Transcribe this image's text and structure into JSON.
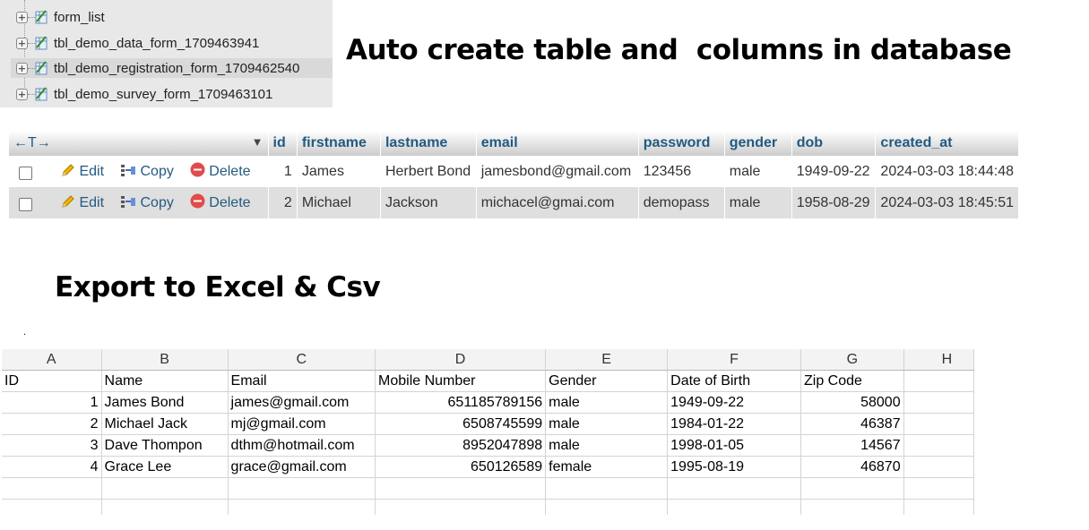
{
  "tree": {
    "items": [
      {
        "label": "form_list"
      },
      {
        "label": "tbl_demo_data_form_1709463941"
      },
      {
        "label": "tbl_demo_registration_form_1709462540"
      },
      {
        "label": "tbl_demo_survey_form_1709463101"
      }
    ]
  },
  "headings": {
    "top": "Auto create table and  columns in database",
    "export": "Export to Excel & Csv",
    "dot": "."
  },
  "dbtable": {
    "columns": [
      "id",
      "firstname",
      "lastname",
      "email",
      "password",
      "gender",
      "dob",
      "created_at"
    ],
    "actions": {
      "edit": "Edit",
      "copy": "Copy",
      "delete": "Delete"
    },
    "rows": [
      [
        "1",
        "James",
        "Herbert Bond",
        "jamesbond@gmail.com",
        "123456",
        "male",
        "1949-09-22",
        "2024-03-03 18:44:48"
      ],
      [
        "2",
        "Michael",
        "Jackson",
        "michacel@gmai.com",
        "demopass",
        "male",
        "1958-08-29",
        "2024-03-03 18:45:51"
      ]
    ]
  },
  "sheet": {
    "col_letters": [
      "A",
      "B",
      "C",
      "D",
      "E",
      "F",
      "G",
      "H"
    ],
    "headers": [
      "ID",
      "Name",
      "Email",
      "Mobile Number",
      "Gender",
      "Date of Birth",
      "Zip Code"
    ],
    "rows": [
      [
        "1",
        "James Bond",
        "james@gmail.com",
        "651185789156",
        "male",
        "1949-09-22",
        "58000"
      ],
      [
        "2",
        "Michael Jack",
        "mj@gmail.com",
        "6508745599",
        "male",
        "1984-01-22",
        "46387"
      ],
      [
        "3",
        "Dave Thompon",
        "dthm@hotmail.com",
        "8952047898",
        "male",
        "1998-01-05",
        "14567"
      ],
      [
        "4",
        "Grace Lee",
        "grace@gmail.com",
        "650126589",
        "female",
        "1995-08-19",
        "46870"
      ]
    ]
  },
  "colors": {
    "link": "#235a81",
    "header_grad_top": "#ffffff",
    "header_grad_bottom": "#cccccc"
  }
}
